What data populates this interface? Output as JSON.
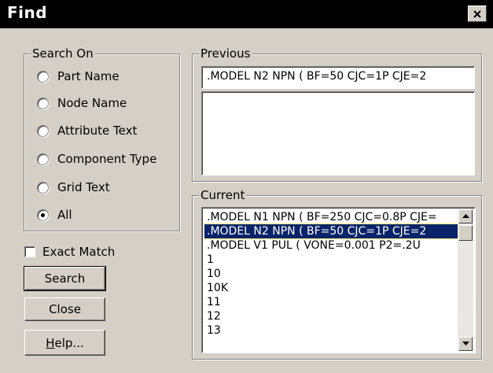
{
  "window": {
    "title": "Find",
    "close_glyph": "×"
  },
  "search_on": {
    "label": "Search On",
    "options": [
      {
        "label": "Part Name",
        "checked": false
      },
      {
        "label": "Node Name",
        "checked": false
      },
      {
        "label": "Attribute Text",
        "checked": false
      },
      {
        "label": "Component Type",
        "checked": false
      },
      {
        "label": "Grid Text",
        "checked": false
      },
      {
        "label": "All",
        "checked": true
      }
    ]
  },
  "exact_match": {
    "label": "Exact Match",
    "checked": false
  },
  "buttons": {
    "search": "Search",
    "close": "Close",
    "help_mnemonic": "H",
    "help_rest": "elp..."
  },
  "previous": {
    "label": "Previous",
    "value": ".MODEL N2 NPN ( BF=50 CJC=1P CJE=2"
  },
  "current": {
    "label": "Current",
    "items": [
      ".MODEL N1 NPN ( BF=250 CJC=0.8P CJE=",
      ".MODEL N2 NPN ( BF=50 CJC=1P CJE=2",
      ".MODEL V1 PUL ( VONE=0.001 P2=.2U",
      "1",
      "10",
      "10K",
      "11",
      "12",
      "13"
    ],
    "selected_index": 1
  },
  "icons": {
    "scroll_up": "scroll-up-arrow-icon",
    "scroll_down": "scroll-down-arrow-icon",
    "close": "close-x-icon"
  }
}
